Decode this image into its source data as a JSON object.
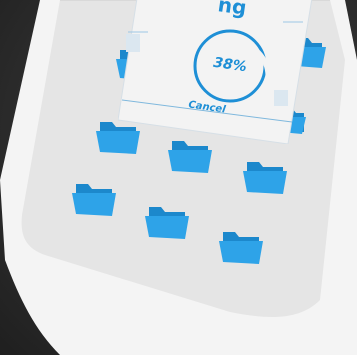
{
  "dialog": {
    "title_fragment": "ng",
    "progress_percent": 38,
    "progress_label": "38%",
    "cancel_label": "Cancel"
  },
  "colors": {
    "accent": "#1e8fd6",
    "folder": "#2ea3e8",
    "screen": "#e6e6e6",
    "background": "#333333"
  },
  "icons": [
    "folder-icon"
  ]
}
